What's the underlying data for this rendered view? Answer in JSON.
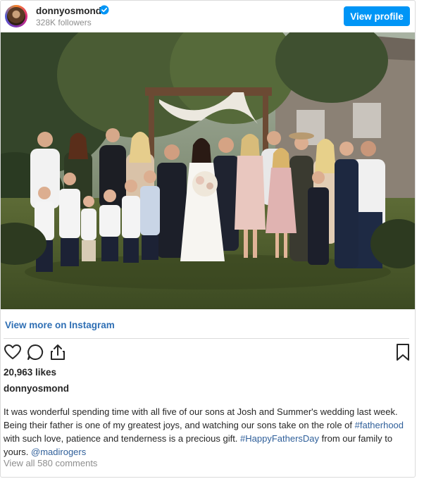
{
  "post": {
    "username": "donnyosmond",
    "followers": "328K followers",
    "view_profile_label": "View profile",
    "view_more_label": "View more on Instagram",
    "likes": "20,963 likes",
    "caption_user": "donnyosmond",
    "caption": {
      "text_1": "It was wonderful spending time with all five of our sons at Josh and Summer's wedding last week. Being their father is one of my greatest joys, and watching our sons take on the role of ",
      "tag_1": "#fatherhood",
      "text_2": " with such love, patience and tenderness is a precious gift. ",
      "tag_2": "#HappyFathersDay",
      "text_3": " from our family to yours. ",
      "mention": "@madirogers"
    },
    "comments_label": "View all 580 comments"
  },
  "icons": {
    "verified": "verified-badge-icon",
    "like": "heart-icon",
    "comment": "comment-icon",
    "share": "share-icon",
    "save": "bookmark-icon"
  },
  "colors": {
    "accent": "#0095f6",
    "link": "#2f6fb4",
    "hashtag": "#2f5f9a",
    "muted": "#8e8e8e",
    "text": "#262626",
    "border": "#dbdbdb"
  }
}
